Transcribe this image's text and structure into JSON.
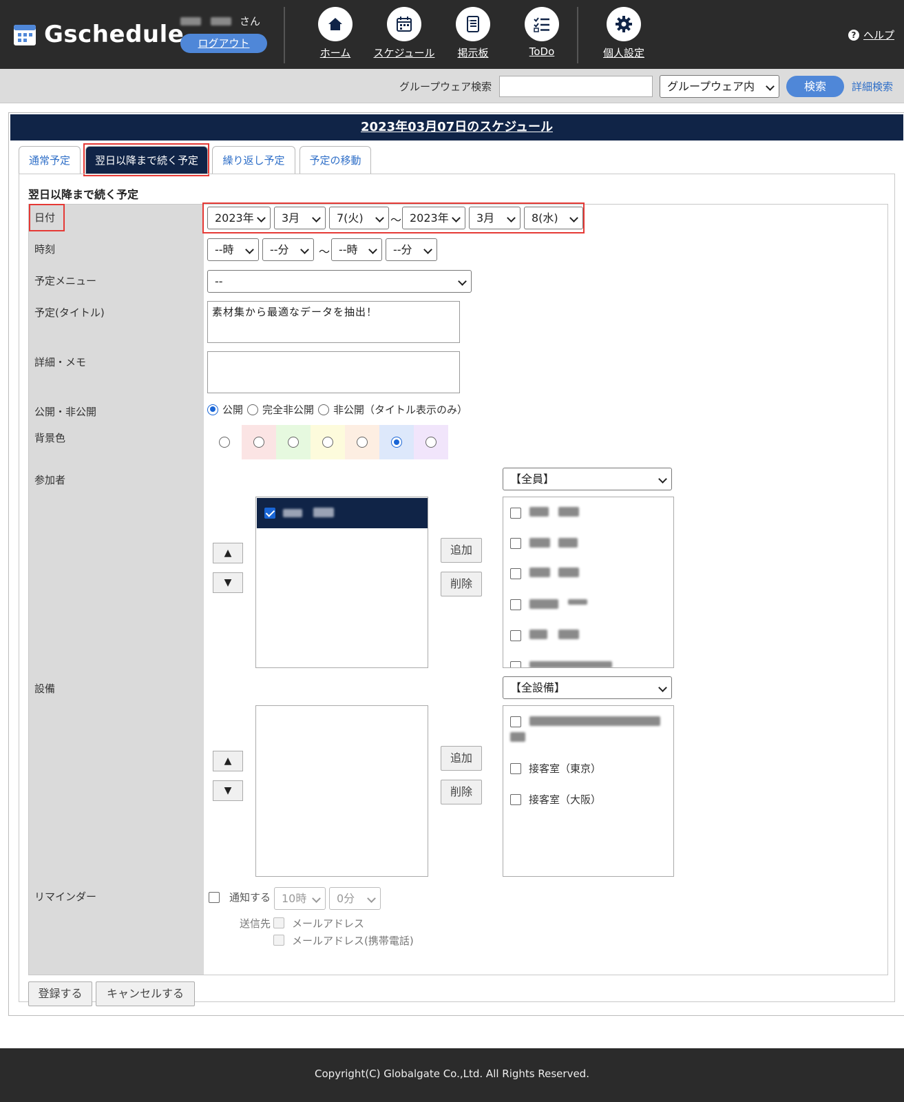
{
  "header": {
    "logo_text": "Gschedule",
    "user_suffix": "さん",
    "logout_label": "ログアウト",
    "nav": [
      {
        "label": "ホーム",
        "icon": "home-icon"
      },
      {
        "label": "スケジュール",
        "icon": "calendar-icon"
      },
      {
        "label": "掲示板",
        "icon": "bulletin-icon"
      },
      {
        "label": "ToDo",
        "icon": "todo-list-icon"
      },
      {
        "label": "個人設定",
        "icon": "gear-icon"
      }
    ],
    "help_label": "ヘルプ"
  },
  "search": {
    "label": "グループウェア検索",
    "input_value": "",
    "scope_selected": "グループウェア内",
    "button_label": "検索",
    "advanced_label": "詳細検索"
  },
  "panel": {
    "title": "2023年03月07日のスケジュール",
    "tabs": [
      {
        "label": "通常予定",
        "active": false
      },
      {
        "label": "翌日以降まで続く予定",
        "active": true
      },
      {
        "label": "繰り返し予定",
        "active": false
      },
      {
        "label": "予定の移動",
        "active": false
      }
    ],
    "section_title": "翌日以降まで続く予定"
  },
  "form": {
    "labels": {
      "date": "日付",
      "time": "時刻",
      "menu": "予定メニュー",
      "title": "予定(タイトル)",
      "memo": "詳細・メモ",
      "visibility": "公開・非公開",
      "bgcolor": "背景色",
      "participants": "参加者",
      "facility": "設備",
      "reminder": "リマインダー"
    },
    "date": {
      "start_year": "2023年",
      "start_month": "3月",
      "start_day": "7(火)",
      "tilde": "～",
      "end_year": "2023年",
      "end_month": "3月",
      "end_day": "8(水)"
    },
    "time": {
      "start_hour": "--時",
      "start_min": "--分",
      "tilde": "～",
      "end_hour": "--時",
      "end_min": "--分"
    },
    "menu_selected": "--",
    "title_value": "素材集から最適なデータを抽出！",
    "memo_value": "",
    "visibility": {
      "options": [
        "公開",
        "完全非公開",
        "非公開（タイトル表示のみ）"
      ],
      "selected": "公開"
    },
    "bgcolor": {
      "colors": [
        "#ffffff",
        "#fbe4e4",
        "#e6f9df",
        "#fdfbdc",
        "#fdeee2",
        "#dde8fb",
        "#f1e5fb"
      ],
      "selected_index": 5
    },
    "participants": {
      "group_selected": "【全員】",
      "add_label": "追加",
      "remove_label": "削除",
      "up_symbol": "▲",
      "down_symbol": "▼"
    },
    "facility": {
      "group_selected": "【全設備】",
      "add_label": "追加",
      "remove_label": "削除",
      "up_symbol": "▲",
      "down_symbol": "▼",
      "items": [
        "接客室（東京）",
        "接客室（大阪）"
      ]
    },
    "reminder": {
      "notify_label": "通知する",
      "hour": "10時",
      "minute": "0分",
      "send_to_label": "送信先",
      "email_label": "メールアドレス",
      "mobile_email_label": "メールアドレス(携帯電話)"
    },
    "submit_label": "登録する",
    "cancel_label": "キャンセルする"
  },
  "footer": {
    "copyright": "Copyright(C) Globalgate Co.,Ltd. All Rights Reserved."
  }
}
